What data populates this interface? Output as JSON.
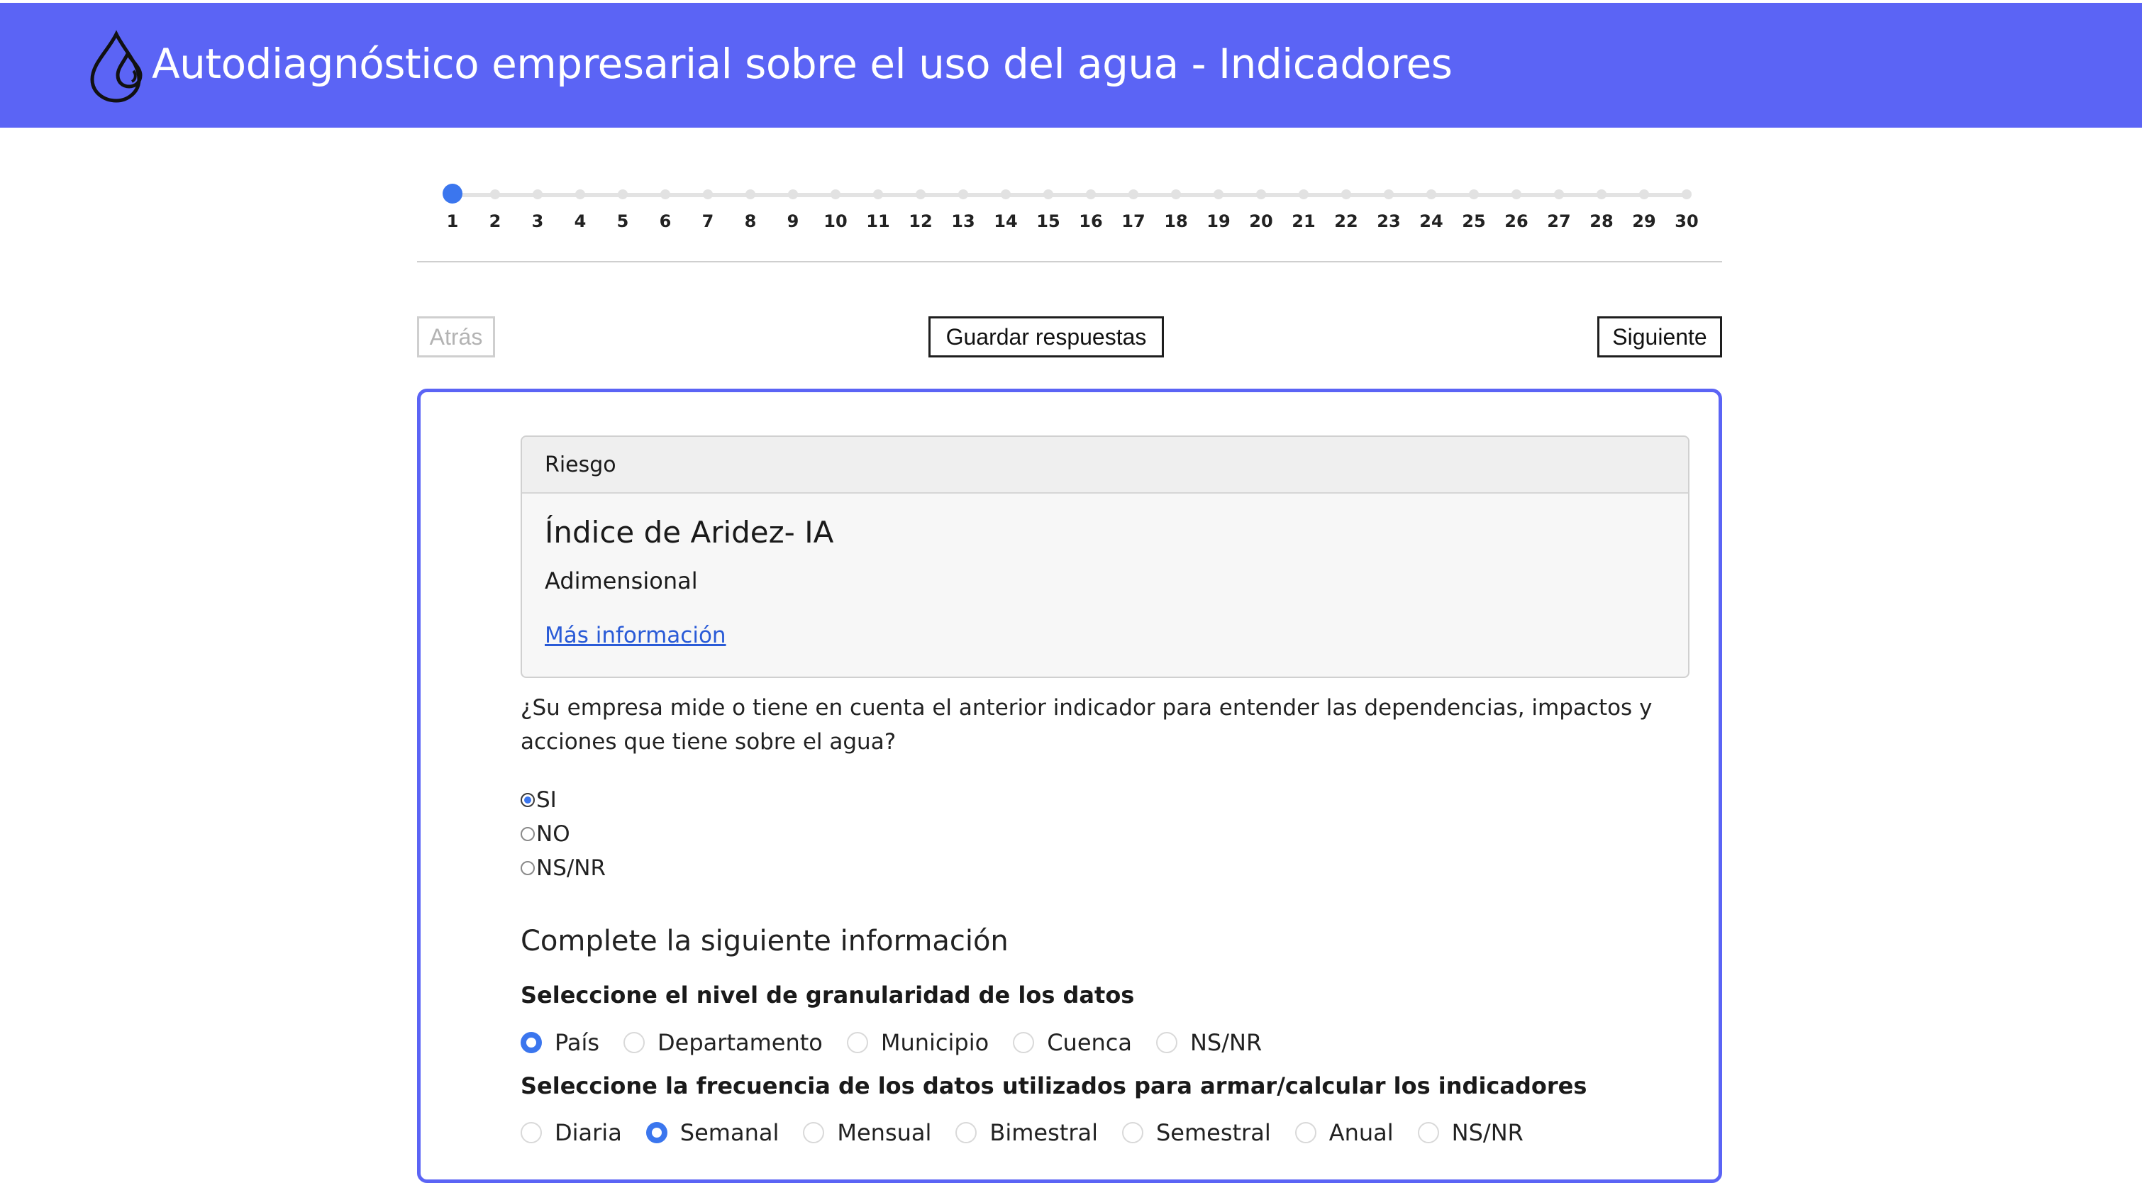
{
  "header": {
    "title": "Autodiagnóstico empresarial sobre el uso del agua - Indicadores",
    "logo_icon": "water-drops-icon",
    "bg_color": "#5b64f5"
  },
  "stepper": {
    "steps": [
      "1",
      "2",
      "3",
      "4",
      "5",
      "6",
      "7",
      "8",
      "9",
      "10",
      "11",
      "12",
      "13",
      "14",
      "15",
      "16",
      "17",
      "18",
      "19",
      "20",
      "21",
      "22",
      "23",
      "24",
      "25",
      "26",
      "27",
      "28",
      "29",
      "30"
    ],
    "current": 1,
    "active_color": "#3b76ee"
  },
  "nav": {
    "back_label": "Atrás",
    "save_label": "Guardar respuestas",
    "next_label": "Siguiente"
  },
  "card": {
    "category": "Riesgo",
    "indicator": "Índice de Aridez- IA",
    "unit": "Adimensional",
    "more_link": "Más información"
  },
  "question": {
    "text": "¿Su empresa mide o tiene en cuenta el anterior indicador para entender las dependencias, impactos y acciones que tiene sobre el agua?",
    "options": [
      "SI",
      "NO",
      "NS/NR"
    ],
    "selected": "SI"
  },
  "complete": {
    "heading": "Complete la siguiente información",
    "granularity": {
      "label": "Seleccione el nivel de granularidad de los datos",
      "options": [
        "País",
        "Departamento",
        "Municipio",
        "Cuenca",
        "NS/NR"
      ],
      "selected": "País"
    },
    "frequency": {
      "label": "Seleccione la frecuencia de los datos utilizados para armar/calcular los indicadores",
      "options": [
        "Diaria",
        "Semanal",
        "Mensual",
        "Bimestral",
        "Semestral",
        "Anual",
        "NS/NR"
      ],
      "selected": "Semanal"
    }
  }
}
